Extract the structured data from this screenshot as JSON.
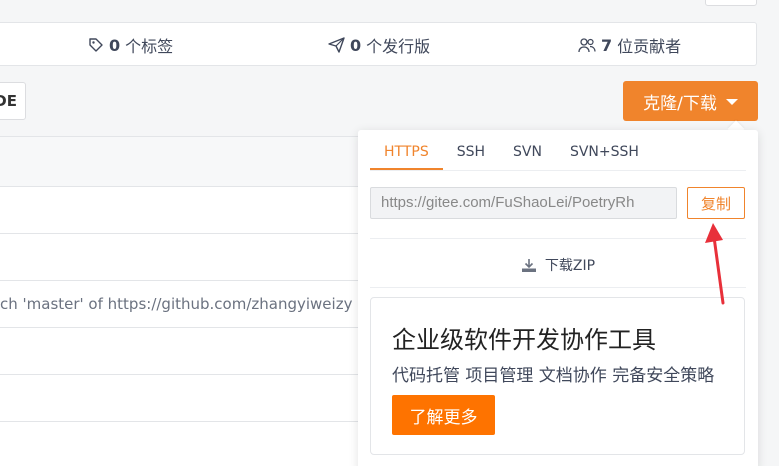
{
  "stats": {
    "tags_count": "0",
    "tags_label": "个标签",
    "releases_count": "0",
    "releases_label": "个发行版",
    "contributors_count": "7",
    "contributors_label": "位贡献者"
  },
  "toolbar": {
    "ide_label": "IDE",
    "clone_label": "克隆/下载"
  },
  "file_list": {
    "commit_message": "ch 'master' of https://github.com/zhangyiweizy"
  },
  "clone_panel": {
    "tabs": [
      "HTTPS",
      "SSH",
      "SVN",
      "SVN+SSH"
    ],
    "active_tab": "HTTPS",
    "url_value": "https://gitee.com/FuShaoLei/PoetryRh",
    "copy_label": "复制",
    "download_zip_label": "下载ZIP"
  },
  "promo": {
    "title": "企业级软件开发协作工具",
    "subtitle": "代码托管 项目管理 文档协作 完备安全策略",
    "button_label": "了解更多"
  },
  "colors": {
    "accent": "#f0842c",
    "promo_button": "#fe7300",
    "annotation": "#e8303a"
  }
}
